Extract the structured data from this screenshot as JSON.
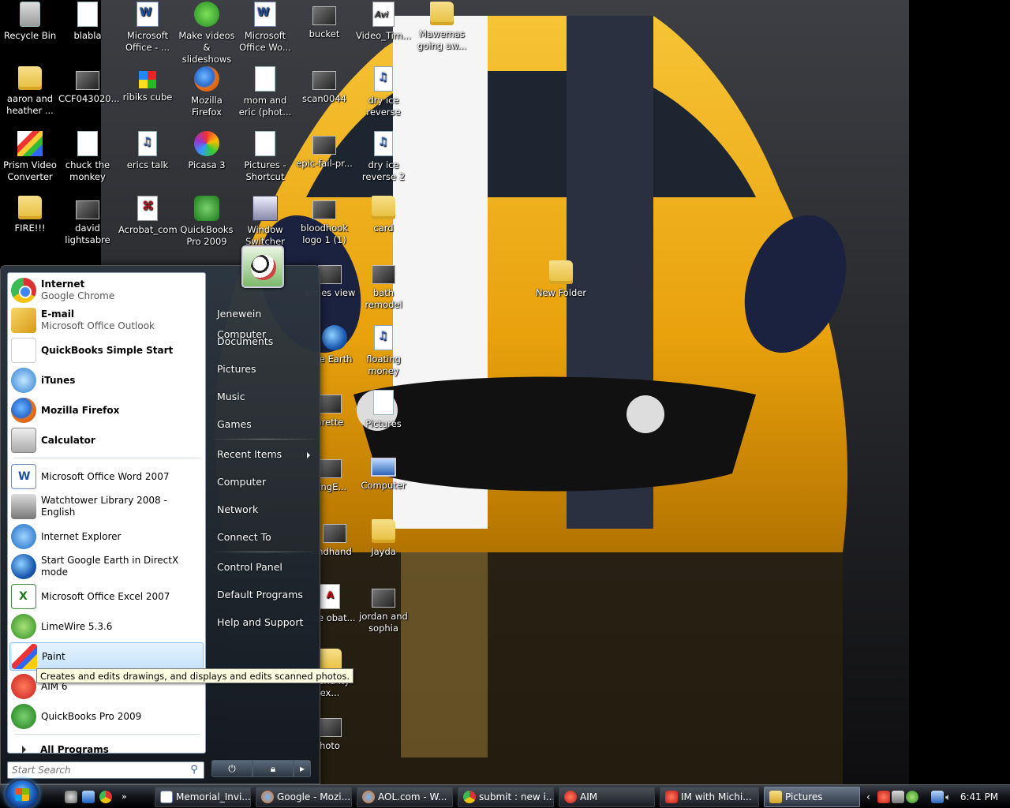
{
  "desktop": {
    "icons": [
      {
        "label": "Recycle Bin",
        "icon": "recycle-bin-icon"
      },
      {
        "label": "blabla",
        "icon": "document-icon"
      },
      {
        "label": "Microsoft Office - ...",
        "icon": "office-icon"
      },
      {
        "label": "Make videos & slideshows",
        "icon": "movie-maker-icon"
      },
      {
        "label": "Microsoft Office Wo...",
        "icon": "word-icon"
      },
      {
        "label": "bucket",
        "icon": "image-icon"
      },
      {
        "label": "Video_Tim...",
        "icon": "avi-icon"
      },
      {
        "label": "Mawemas going aw...",
        "icon": "folder-icon"
      },
      {
        "label": "aaron and heather ...",
        "icon": "folder-icon"
      },
      {
        "label": "CCF043020...",
        "icon": "image-icon"
      },
      {
        "label": "ribiks cube",
        "icon": "rubiks-cube-icon"
      },
      {
        "label": "Mozilla Firefox",
        "icon": "firefox-icon"
      },
      {
        "label": "mom and eric (phot...",
        "icon": "shortcut-icon"
      },
      {
        "label": "scan0044",
        "icon": "image-icon"
      },
      {
        "label": "dry ice reverse",
        "icon": "audio-icon"
      },
      {
        "label": "Prism Video Converter",
        "icon": "prism-icon"
      },
      {
        "label": "chuck the monkey",
        "icon": "document-icon"
      },
      {
        "label": "erics talk",
        "icon": "audio-icon"
      },
      {
        "label": "Picasa 3",
        "icon": "picasa-icon"
      },
      {
        "label": "Pictures - Shortcut",
        "icon": "shortcut-icon"
      },
      {
        "label": "epic-fail-pr...",
        "icon": "image-icon"
      },
      {
        "label": "dry ice reverse 2",
        "icon": "audio-icon"
      },
      {
        "label": "FIRE!!!",
        "icon": "folder-icon"
      },
      {
        "label": "david lightsabre",
        "icon": "video-icon"
      },
      {
        "label": "Acrobat_com",
        "icon": "acrobat-icon"
      },
      {
        "label": "QuickBooks Pro 2009",
        "icon": "quickbooks-icon"
      },
      {
        "label": "Window Switcher",
        "icon": "window-switcher-icon"
      },
      {
        "label": "bloodhook logo 1 (1)",
        "icon": "image-icon"
      },
      {
        "label": "card",
        "icon": "folder-icon"
      },
      {
        "label": "annes view",
        "icon": "image-icon"
      },
      {
        "label": "bath remodel",
        "icon": "image-icon"
      },
      {
        "label": "New Folder",
        "icon": "folder-icon"
      },
      {
        "label": "le Earth",
        "icon": "google-earth-icon"
      },
      {
        "label": "floating money",
        "icon": "audio-icon"
      },
      {
        "label": "arette",
        "icon": "image-icon"
      },
      {
        "label": "Pictures",
        "icon": "shortcut-icon"
      },
      {
        "label": "kingE...",
        "icon": "image-icon"
      },
      {
        "label": "Computer",
        "icon": "computer-icon"
      },
      {
        "label": "ndhand",
        "icon": "image-icon"
      },
      {
        "label": "Jayda",
        "icon": "folder-icon"
      },
      {
        "label": "lobe obat...",
        "icon": "pdf-icon"
      },
      {
        "label": "jordan and sophia",
        "icon": "image-icon"
      },
      {
        "label": "e and ity ex...",
        "icon": "folder-icon"
      },
      {
        "label": "hoto",
        "icon": "image-icon"
      }
    ]
  },
  "start_menu": {
    "pinned": [
      {
        "title": "Internet",
        "subtitle": "Google Chrome",
        "icon": "chrome-icon"
      },
      {
        "title": "E-mail",
        "subtitle": "Microsoft Office Outlook",
        "icon": "outlook-icon"
      }
    ],
    "recent": [
      {
        "label": "QuickBooks Simple Start",
        "icon": "quickbooks-simple-start-icon",
        "bold": true
      },
      {
        "label": "iTunes",
        "icon": "itunes-icon",
        "bold": true
      },
      {
        "label": "Mozilla Firefox",
        "icon": "firefox-icon",
        "bold": true
      },
      {
        "label": "Calculator",
        "icon": "calculator-icon",
        "bold": true
      },
      {
        "label": "Microsoft Office Word 2007",
        "icon": "word-icon",
        "bold": false
      },
      {
        "label": "Watchtower Library 2008 - English",
        "icon": "watchtower-icon",
        "bold": false
      },
      {
        "label": "Internet Explorer",
        "icon": "internet-explorer-icon",
        "bold": false
      },
      {
        "label": "Start Google Earth in DirectX mode",
        "icon": "google-earth-icon",
        "bold": false
      },
      {
        "label": "Microsoft Office Excel 2007",
        "icon": "excel-icon",
        "bold": false
      },
      {
        "label": "LimeWire 5.3.6",
        "icon": "limewire-icon",
        "bold": false
      },
      {
        "label": "Paint",
        "icon": "paint-icon",
        "bold": false
      },
      {
        "label": "AIM 6",
        "icon": "aim-icon",
        "bold": false
      },
      {
        "label": "QuickBooks Pro 2009",
        "icon": "quickbooks-icon",
        "bold": false
      }
    ],
    "all_programs": "All Programs",
    "search_placeholder": "Start Search",
    "tooltip": "Creates and edits drawings, and displays and edits scanned photos.",
    "right_links": {
      "user": "Jenewein Computer",
      "documents": "Documents",
      "pictures": "Pictures",
      "music": "Music",
      "games": "Games",
      "recent_items": "Recent Items",
      "computer": "Computer",
      "network": "Network",
      "connect_to": "Connect To",
      "control_panel": "Control Panel",
      "default_programs": "Default Programs",
      "help_and_support": "Help and Support"
    }
  },
  "taskbar": {
    "tasks": [
      {
        "label": "Memorial_Invi...",
        "icon": "word-icon"
      },
      {
        "label": "Google - Mozi...",
        "icon": "firefox-icon"
      },
      {
        "label": "AOL.com - W...",
        "icon": "firefox-icon"
      },
      {
        "label": "submit : new i...",
        "icon": "chrome-icon"
      },
      {
        "label": "AIM",
        "icon": "aim-icon"
      },
      {
        "label": "IM with Michi...",
        "icon": "aim-im-icon"
      },
      {
        "label": "Pictures",
        "icon": "folder-icon"
      }
    ],
    "clock": "6:41 PM"
  }
}
